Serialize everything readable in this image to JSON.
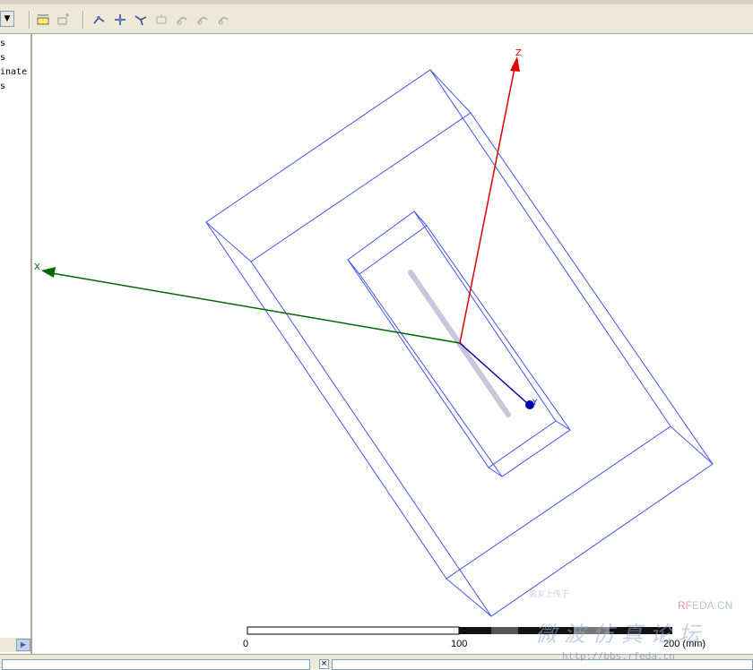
{
  "tree": {
    "items": [
      "s",
      "s",
      "inate",
      "s"
    ]
  },
  "toolbar": {
    "buttons": [
      "fit-all-icon",
      "fit-selection-icon",
      "rotate-icon",
      "pan-icon",
      "zoom-icon",
      "orient-icon",
      "view-1-icon",
      "view-2-icon",
      "view-3-icon"
    ]
  },
  "axes": {
    "x_label": "X",
    "y_label": "Y",
    "z_label": "Z",
    "x_color": "#006600",
    "y_color": "#0000aa",
    "z_color": "#dd0000"
  },
  "model": {
    "wire_color": "#4455ee",
    "probe_color": "#c8c6d8"
  },
  "scale_bar": {
    "tick_0": "0",
    "tick_100": "100",
    "tick_200": "200 (mm)"
  },
  "watermark": {
    "brand_r": "RF",
    "brand_rest": "EDA.CN",
    "chinese": "微波仿真论坛",
    "url": "http://bbs.rfeda.cn",
    "top": "鹏友上传于"
  }
}
